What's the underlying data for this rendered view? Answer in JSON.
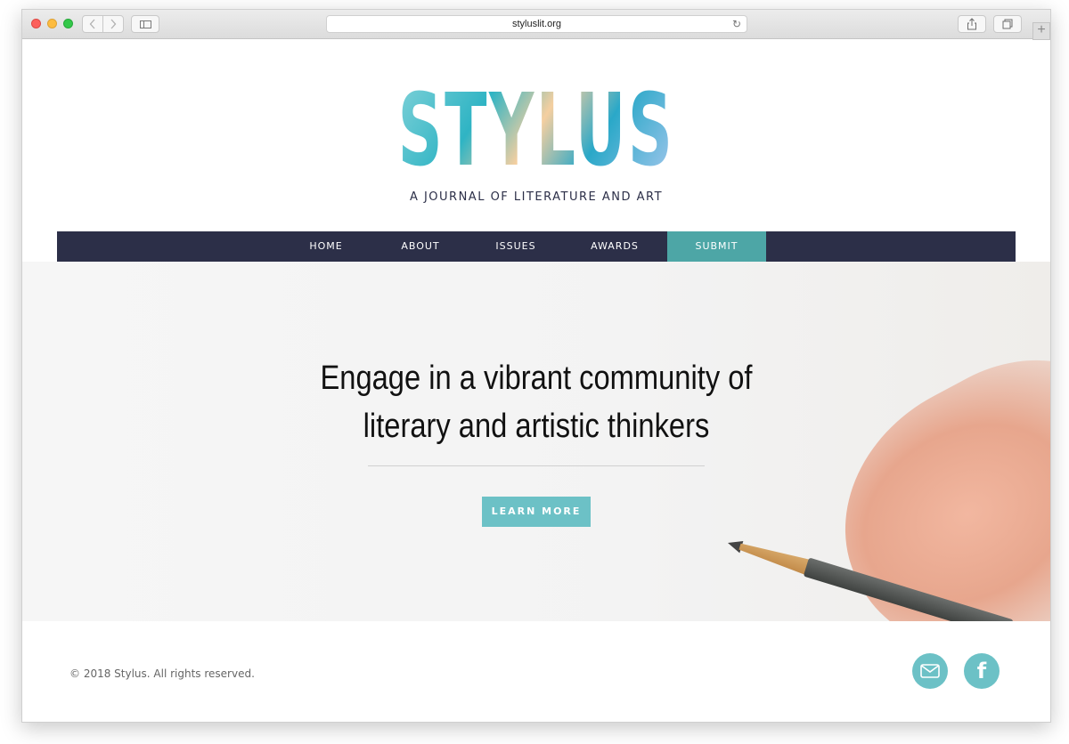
{
  "browser": {
    "url": "styluslit.org",
    "icons": [
      "close",
      "minimize",
      "maximize",
      "back",
      "forward",
      "sidebar",
      "reload",
      "share",
      "tabs",
      "new-tab"
    ],
    "new_tab_glyph": "+"
  },
  "header": {
    "logo_text": "STYLUS",
    "tagline": "A JOURNAL OF LITERATURE AND ART"
  },
  "nav": {
    "items": [
      {
        "label": "HOME"
      },
      {
        "label": "ABOUT"
      },
      {
        "label": "ISSUES"
      },
      {
        "label": "AWARDS"
      },
      {
        "label": "SUBMIT",
        "active": true
      }
    ],
    "background": "#2c2f48",
    "active_color": "#4da6a6"
  },
  "hero": {
    "line1": "Engage in a vibrant community of",
    "line2": "literary and artistic thinkers",
    "button_label": "LEARN MORE",
    "button_color": "#6cc1c6"
  },
  "footer": {
    "copyright": "© 2018 Stylus. All rights reserved.",
    "social": [
      "email-icon",
      "facebook-icon"
    ]
  }
}
